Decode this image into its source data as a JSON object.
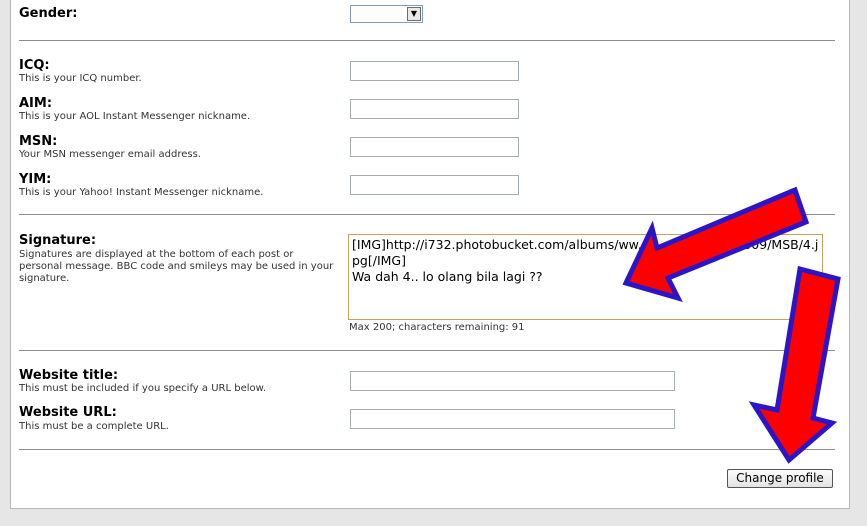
{
  "fields": {
    "gender": {
      "label": "Gender:"
    },
    "icq": {
      "label": "ICQ:",
      "desc": "This is your ICQ number.",
      "value": ""
    },
    "aim": {
      "label": "AIM:",
      "desc": "This is your AOL Instant Messenger nickname.",
      "value": ""
    },
    "msn": {
      "label": "MSN:",
      "desc": "Your MSN messenger email address.",
      "value": ""
    },
    "yim": {
      "label": "YIM:",
      "desc": "This is your Yahoo! Instant Messenger nickname.",
      "value": ""
    },
    "signature": {
      "label": "Signature:",
      "desc": "Signatures are displayed at the bottom of each post or personal message. BBC code and smileys may be used in your signature.",
      "value": "[IMG]http://i732.photobucket.com/albums/ww.....................1_2009/MSB/4.jpg[/IMG]\nWa dah 4.. lo olang bila lagi ??",
      "remaining": "Max 200; characters remaining: 91"
    },
    "website_title": {
      "label": "Website title:",
      "desc": "This must be included if you specify a URL below.",
      "value": ""
    },
    "website_url": {
      "label": "Website URL:",
      "desc": "This must be a complete URL.",
      "value": ""
    }
  },
  "submit_label": "Change profile",
  "colors": {
    "arrow_fill": "#ff0000",
    "arrow_stroke": "#2a16c8"
  }
}
